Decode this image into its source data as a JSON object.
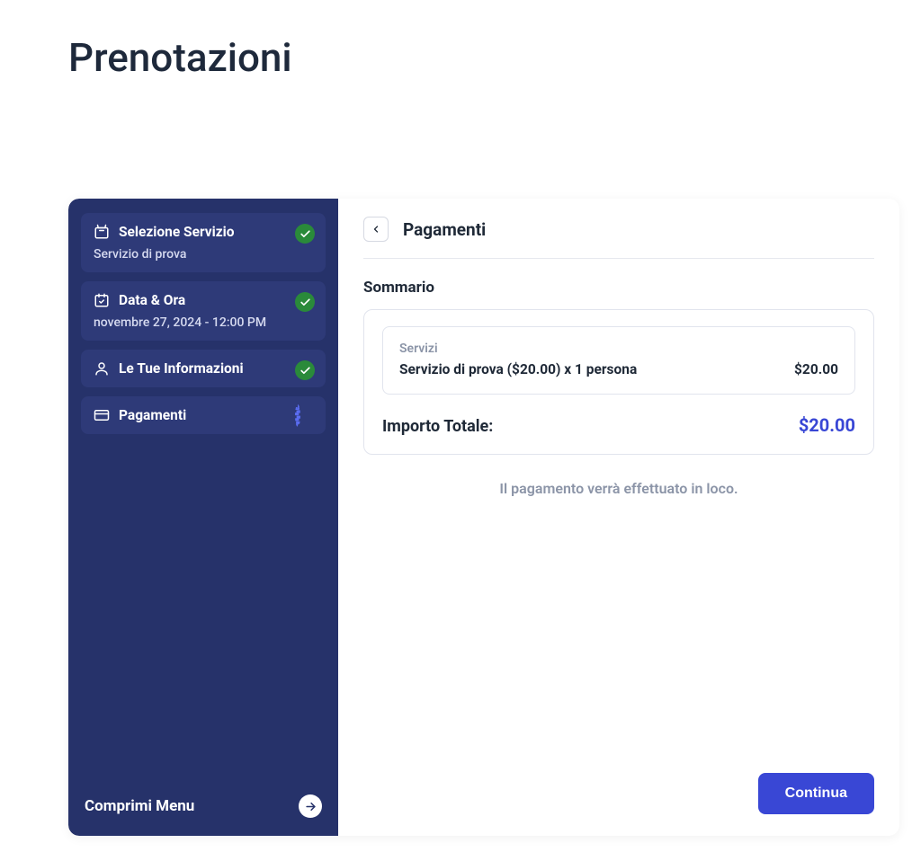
{
  "page": {
    "title": "Prenotazioni"
  },
  "sidebar": {
    "steps": [
      {
        "title": "Selezione Servizio",
        "subtitle": "Servizio di prova",
        "status": "done"
      },
      {
        "title": "Data & Ora",
        "subtitle": "novembre 27, 2024 - 12:00 PM",
        "status": "done"
      },
      {
        "title": "Le Tue Informazioni",
        "subtitle": "",
        "status": "done"
      },
      {
        "title": "Pagamenti",
        "subtitle": "",
        "status": "current"
      }
    ],
    "collapse_label": "Comprimi Menu"
  },
  "main": {
    "title": "Pagamenti",
    "summary_label": "Sommario",
    "services_label": "Servizi",
    "service_line_text": "Servizio di prova ($20.00) x 1 persona",
    "service_line_price": "$20.00",
    "total_label": "Importo Totale:",
    "total_amount": "$20.00",
    "note": "Il pagamento verrà effettuato in loco.",
    "continue_label": "Continua"
  }
}
